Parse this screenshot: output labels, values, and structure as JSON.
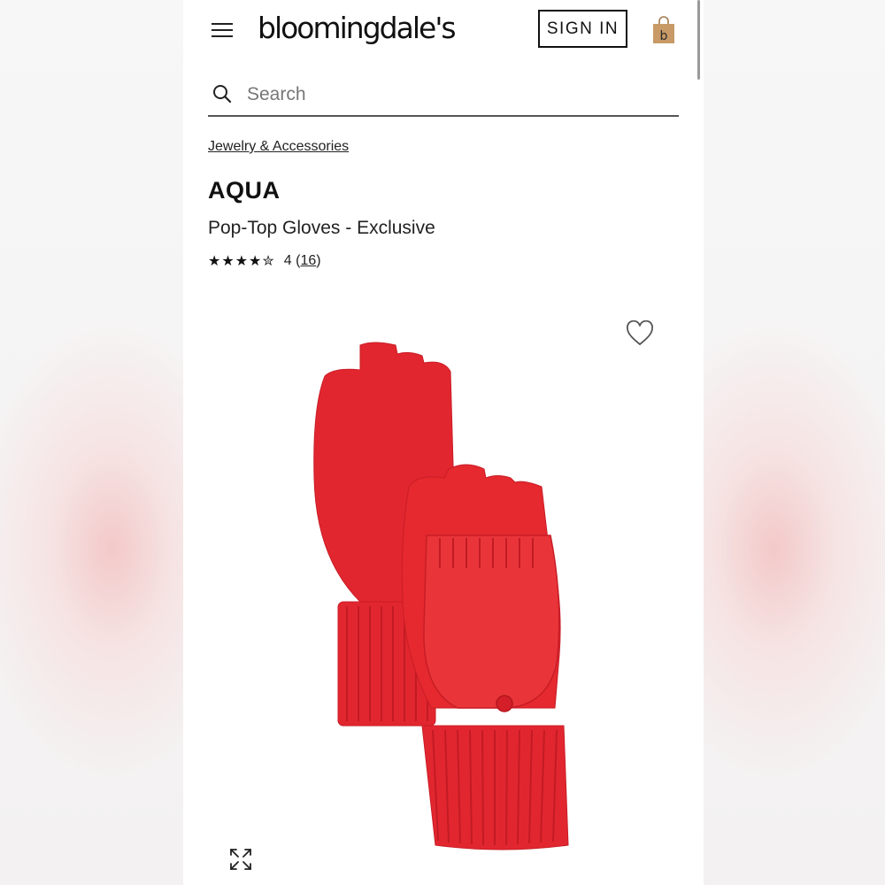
{
  "header": {
    "logo_text": "bloomingdale's",
    "sign_in_label": "SIGN IN",
    "bag_letter": "b"
  },
  "search": {
    "placeholder": "Search"
  },
  "breadcrumb": "Jewelry & Accessories",
  "product": {
    "brand": "AQUA",
    "name": "Pop-Top Gloves - Exclusive",
    "stars": "★★★★✮",
    "rating": 4,
    "rating_prefix": "4 (",
    "review_count": "16",
    "rating_suffix": ")"
  },
  "colors": {
    "product_red": "#e2262f",
    "bag_tan": "#c89a66"
  },
  "icons": {
    "menu": "menu-icon",
    "bag": "shopping-bag-icon",
    "search": "search-icon",
    "favorite": "heart-icon",
    "expand": "expand-icon"
  }
}
